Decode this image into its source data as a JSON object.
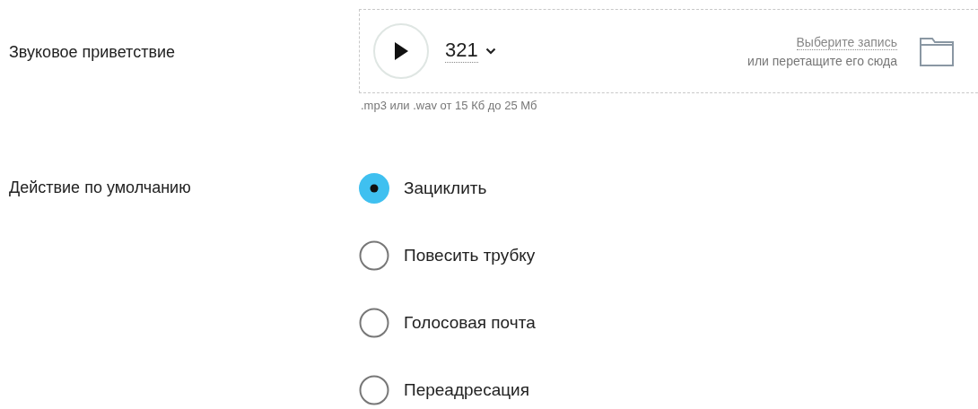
{
  "greeting": {
    "label": "Звуковое приветствие",
    "track": "321",
    "choose_link": "Выберите запись",
    "drop_hint": "или перетащите его сюда",
    "format_hint": ".mp3 или .wav от 15 Кб до 25 Мб"
  },
  "default_action": {
    "label": "Действие по умолчанию",
    "options": [
      {
        "label": "Зациклить",
        "selected": true
      },
      {
        "label": "Повесить трубку",
        "selected": false
      },
      {
        "label": "Голосовая почта",
        "selected": false
      },
      {
        "label": "Переадресация",
        "selected": false
      }
    ]
  }
}
